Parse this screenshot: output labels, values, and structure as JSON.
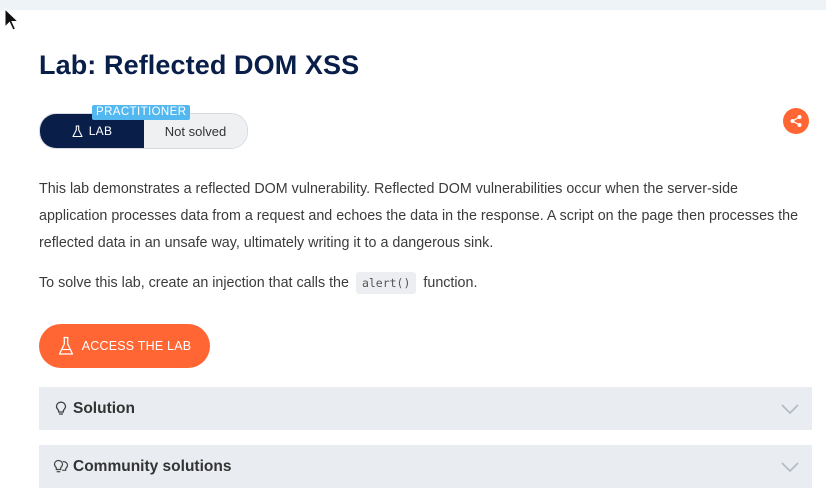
{
  "lab": {
    "title": "Lab: Reflected DOM XSS",
    "level": "PRACTITIONER",
    "lab_label": "LAB",
    "status": "Not solved"
  },
  "description": {
    "text": "This lab demonstrates a reflected DOM vulnerability. Reflected DOM vulnerabilities occur when the server-side application processes data from a request and echoes the data in the response. A script on the page then processes the reflected data in an unsafe way, ultimately writing it to a dangerous sink.",
    "solve_prefix": "To solve this lab, create an injection that calls the",
    "solve_code": "alert()",
    "solve_suffix": "function."
  },
  "actions": {
    "access_label": "ACCESS THE LAB"
  },
  "accordions": [
    {
      "label": "Solution",
      "icon": "lightbulb-icon"
    },
    {
      "label": "Community solutions",
      "icon": "community-icon"
    }
  ],
  "colors": {
    "navy": "#0a1e4a",
    "orange": "#ff6633",
    "practitioner_blue": "#54b8f0",
    "accordion_bg": "#e9edf1"
  }
}
